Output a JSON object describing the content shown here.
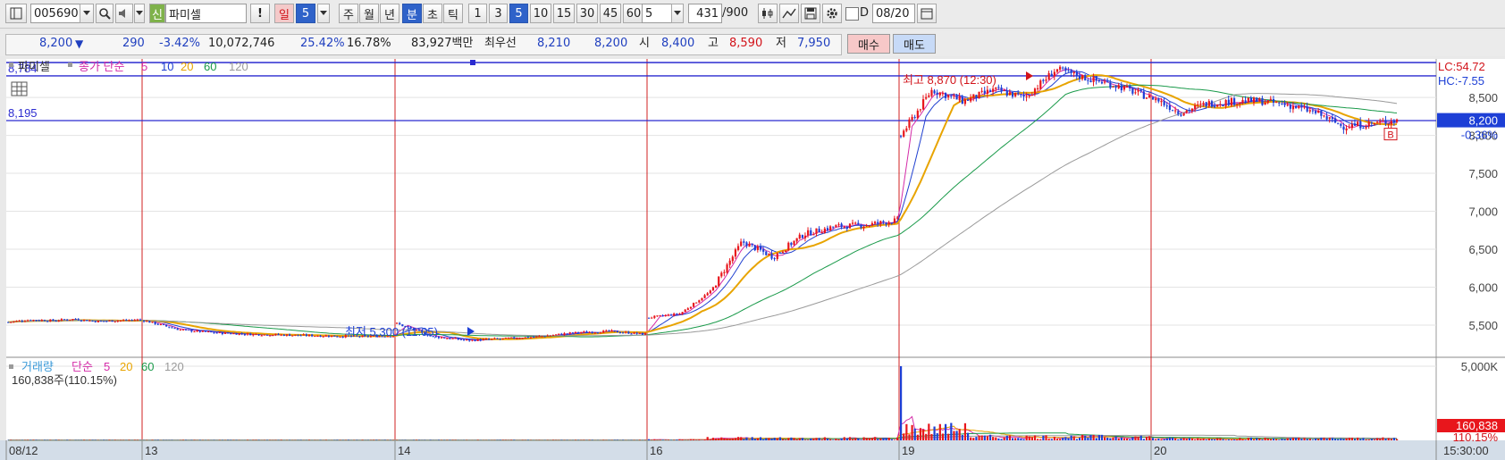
{
  "toolbar": {
    "code": "005690",
    "badge": "신",
    "name": "파미셀",
    "alert": "!",
    "period_day": "일",
    "period_sel": "5",
    "period_week": "주",
    "period_month": "월",
    "period_year": "년",
    "period_min": "분",
    "period_sec": "초",
    "period_tick": "틱",
    "intervals": [
      "1",
      "3",
      "5",
      "10",
      "15",
      "30",
      "45",
      "60"
    ],
    "interval_selected": "5",
    "count_select": "5",
    "count_value": "431",
    "count_total": "/900",
    "checkbox_label": "D",
    "date_value": "08/20"
  },
  "quote": {
    "price": "8,200",
    "arrow": "▼",
    "change": "290",
    "change_pct": "-3.42%",
    "volume": "10,072,746",
    "turnover_pct": "25.42%",
    "rate2": "16.78%",
    "amount": "83,927백만",
    "best_label": "최우선",
    "best_ask": "8,210",
    "best_bid": "8,200",
    "open_label": "시",
    "open": "8,400",
    "high_label": "고",
    "high": "8,590",
    "low_label": "저",
    "low": "7,950",
    "buy_label": "매수",
    "sell_label": "매도"
  },
  "colors": {
    "up": "#e8161c",
    "down": "#1d3fd6",
    "ma5": "#d42ba8",
    "ma10": "#2040d0",
    "ma20": "#e8a400",
    "ma60": "#1a9a4a",
    "ma120": "#9a9a9a",
    "hline": "#2b2bd0",
    "vline": "#d02020"
  },
  "chart_data": [
    {
      "type": "candlestick",
      "legend": {
        "name": "파미셀",
        "label": "종가 단순",
        "ma": [
          "5",
          "10",
          "20",
          "60",
          "120"
        ]
      },
      "y_ticks": [
        "8,500",
        "8,000",
        "7,500",
        "7,000",
        "6,500",
        "6,000",
        "5,500"
      ],
      "ylim": [
        5100,
        8960
      ],
      "hlines": [
        {
          "label": "8,784",
          "value": 8784
        },
        {
          "label": "8,195",
          "value": 8195
        }
      ],
      "top_line_value": 8960,
      "right_labels": {
        "lc": "LC:54.72",
        "hc": "HC:-7.55",
        "price": "8,200",
        "pct": "-0.36%",
        "b_marker": "B"
      },
      "annotations": {
        "high": "최고 8,870 (12:30)",
        "low": "최저 5,300 (11:05)"
      },
      "x_labels": [
        "08/12",
        "13",
        "14",
        "16",
        "19",
        "20",
        "15:30:00"
      ],
      "sessions": [
        {
          "date": "08/12",
          "anchors": [
            5540,
            5570,
            5560,
            5580,
            5550,
            5560,
            5570
          ]
        },
        {
          "date": "13",
          "anchors": [
            5560,
            5440,
            5400,
            5380,
            5370,
            5360,
            5350,
            5360
          ]
        },
        {
          "date": "14",
          "anchors": [
            5520,
            5350,
            5300,
            5320,
            5350,
            5400,
            5420,
            5380
          ]
        },
        {
          "date": "16",
          "anchors": [
            5600,
            5650,
            5950,
            6600,
            6400,
            6700,
            6800,
            6820,
            6880
          ]
        },
        {
          "date": "19",
          "anchors": [
            8000,
            8600,
            8450,
            8600,
            8500,
            8870,
            8750,
            8650,
            8500
          ]
        },
        {
          "date": "20",
          "anchors": [
            8500,
            8300,
            8420,
            8450,
            8450,
            8400,
            8300,
            8120,
            8150,
            8200
          ]
        }
      ]
    },
    {
      "type": "bar",
      "legend": {
        "label": "거래량",
        "label2": "단순",
        "ma": [
          "5",
          "20",
          "60",
          "120"
        ]
      },
      "value_text": "160,838주(110.15%)",
      "y_tick": "5,000K",
      "ylim": [
        0,
        5600
      ],
      "right_labels": {
        "value": "160,838",
        "pct": "110.15%"
      },
      "peak": {
        "session": "19",
        "value": 5000
      }
    }
  ]
}
